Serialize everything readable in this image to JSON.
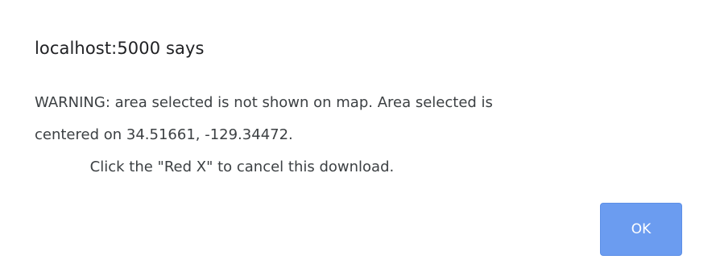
{
  "dialog": {
    "title": "localhost:5000 says",
    "message_lines": [
      "WARNING: area selected is not shown on map. Area selected is",
      "centered on 34.51661, -129.34472.",
      "            Click the \"Red X\" to cancel this download."
    ],
    "ok_label": "OK"
  },
  "colors": {
    "button_bg": "#6b9cf0",
    "button_text": "#ffffff",
    "title_text": "#202124",
    "message_text": "#3c4043"
  }
}
